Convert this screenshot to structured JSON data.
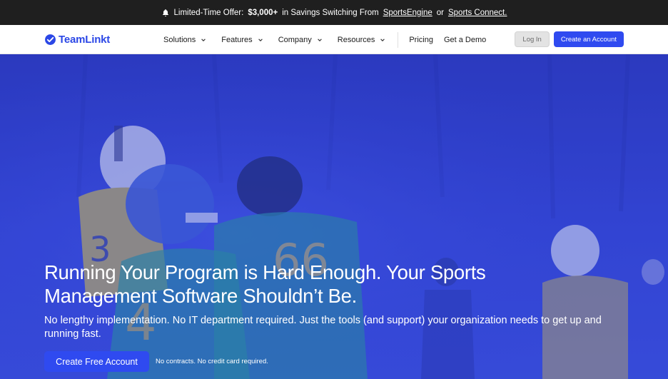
{
  "promo": {
    "prefix": "Limited-Time Offer:",
    "amount": "$3,000+",
    "middle": "in Savings Switching From",
    "link1": "SportsEngine",
    "or": "or",
    "link2": "Sports Connect."
  },
  "nav": {
    "brand": "TeamLinkt",
    "items": [
      {
        "label": "Solutions"
      },
      {
        "label": "Features"
      },
      {
        "label": "Company"
      },
      {
        "label": "Resources"
      }
    ],
    "pricing": "Pricing",
    "demo": "Get a Demo",
    "login": "Log In",
    "create": "Create an Account"
  },
  "hero": {
    "headline_line1": "Running Your Program is Hard Enough. Your Sports",
    "headline_line2": "Management Software Shouldn’t Be.",
    "sub": "No lengthy implementation. No IT department required. Just the tools (and support) your organization needs to get up and running fast.",
    "cta": "Create Free Account",
    "note": "No contracts. No credit card required."
  },
  "colors": {
    "brand_blue": "#2f4af0",
    "promo_bg": "#1f1f1f",
    "hero_overlay": "#2e3fd1"
  }
}
